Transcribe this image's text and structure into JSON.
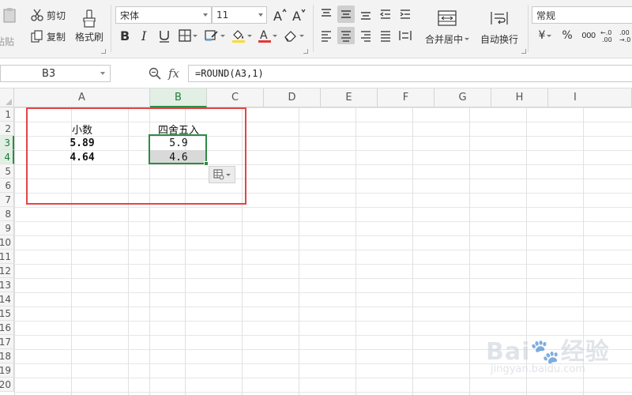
{
  "ribbon": {
    "paste_label": "粘贴",
    "cut_label": "剪切",
    "copy_label": "复制",
    "format_painter_label": "格式刷",
    "font_name": "宋体",
    "font_size": "11",
    "merge_center_label": "合并居中",
    "wrap_text_label": "自动换行",
    "number_format": "常规",
    "percent_symbol": "%",
    "thousands_symbol": "000",
    "inc_decimal_symbol": "+.0 .00",
    "dec_decimal_symbol": ".00 →.0",
    "currency_symbol": "¥"
  },
  "formula_bar": {
    "name_box": "B3",
    "fx_label": "fx",
    "formula": "=ROUND(A3,1)"
  },
  "columns": [
    "A",
    "B",
    "C",
    "D",
    "E",
    "F",
    "G",
    "H",
    "I"
  ],
  "rows": [
    "1",
    "2",
    "3",
    "4",
    "5",
    "6",
    "7",
    "8",
    "9",
    "10",
    "11",
    "12",
    "13",
    "14",
    "15",
    "16",
    "17",
    "18",
    "19",
    "20"
  ],
  "cells": {
    "A2": "小数",
    "B2": "四舍五入",
    "A3": "5.89",
    "B3": "5.9",
    "A4": "4.64",
    "B4": "4.6"
  },
  "colors": {
    "selection": "#2e8b45",
    "annotation": "#e04646",
    "font_color_bar": "#e53935",
    "fill_color_bar": "#fdd835"
  }
}
